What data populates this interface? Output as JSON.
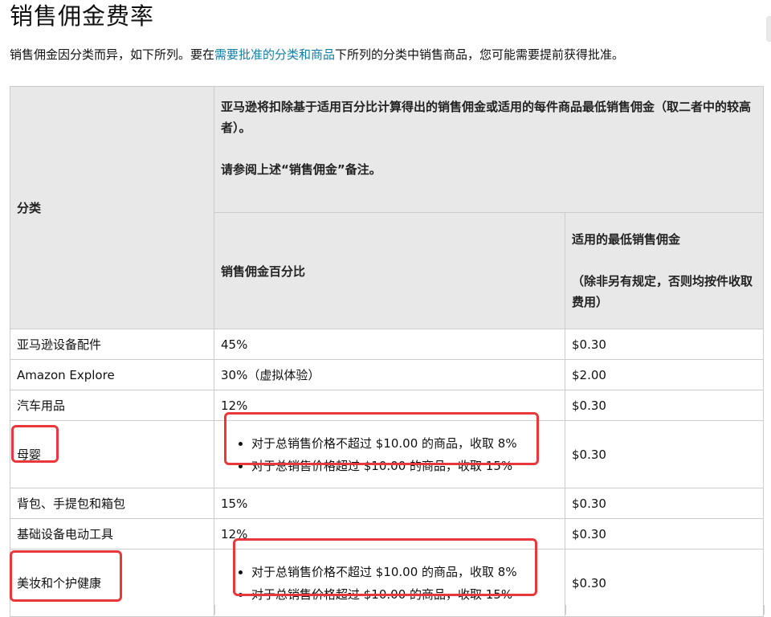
{
  "page": {
    "title": "销售佣金费率",
    "intro_before": "销售佣金因分类而异，如下所列。要在",
    "intro_link": "需要批准的分类和商品",
    "intro_after": "下所列的分类中销售商品，您可能需要提前获得批准。"
  },
  "table": {
    "header": {
      "category": "分类",
      "main_line1": "亚马逊将扣除基于适用百分比计算得出的销售佣金或适用的每件商品最低销售佣金（取二者中的较高者）。",
      "main_line2": "请参阅上述“销售佣金”备注。",
      "percent": "销售佣金百分比",
      "min_line1": "适用的最低销售佣金",
      "min_line2": "（除非另有规定，否则均按件收取费用）"
    },
    "rows": [
      {
        "category": "亚马逊设备配件",
        "percent": "45%",
        "min": "$0.30"
      },
      {
        "category": "Amazon Explore",
        "percent": "30%（虚拟体验）",
        "min": "$2.00"
      },
      {
        "category": "汽车用品",
        "percent": "12%",
        "min": "$0.30"
      },
      {
        "category": "母婴",
        "bullets": [
          "对于总销售价格不超过 $10.00 的商品，收取 8%",
          "对于总销售价格超过 $10.00 的商品，收取 15%"
        ],
        "min": "$0.30"
      },
      {
        "category": "背包、手提包和箱包",
        "percent": "15%",
        "min": "$0.30"
      },
      {
        "category": "基础设备电动工具",
        "percent": "12%",
        "min": "$0.30"
      },
      {
        "category": "美妆和个护健康",
        "bullets": [
          "对于总销售价格不超过 $10.00 的商品，收取 8%",
          "对于总销售价格超过 $10.00 的商品，收取 15%"
        ],
        "min": "$0.30"
      }
    ]
  },
  "annotations": {
    "highlight_color": "#e8383b"
  }
}
